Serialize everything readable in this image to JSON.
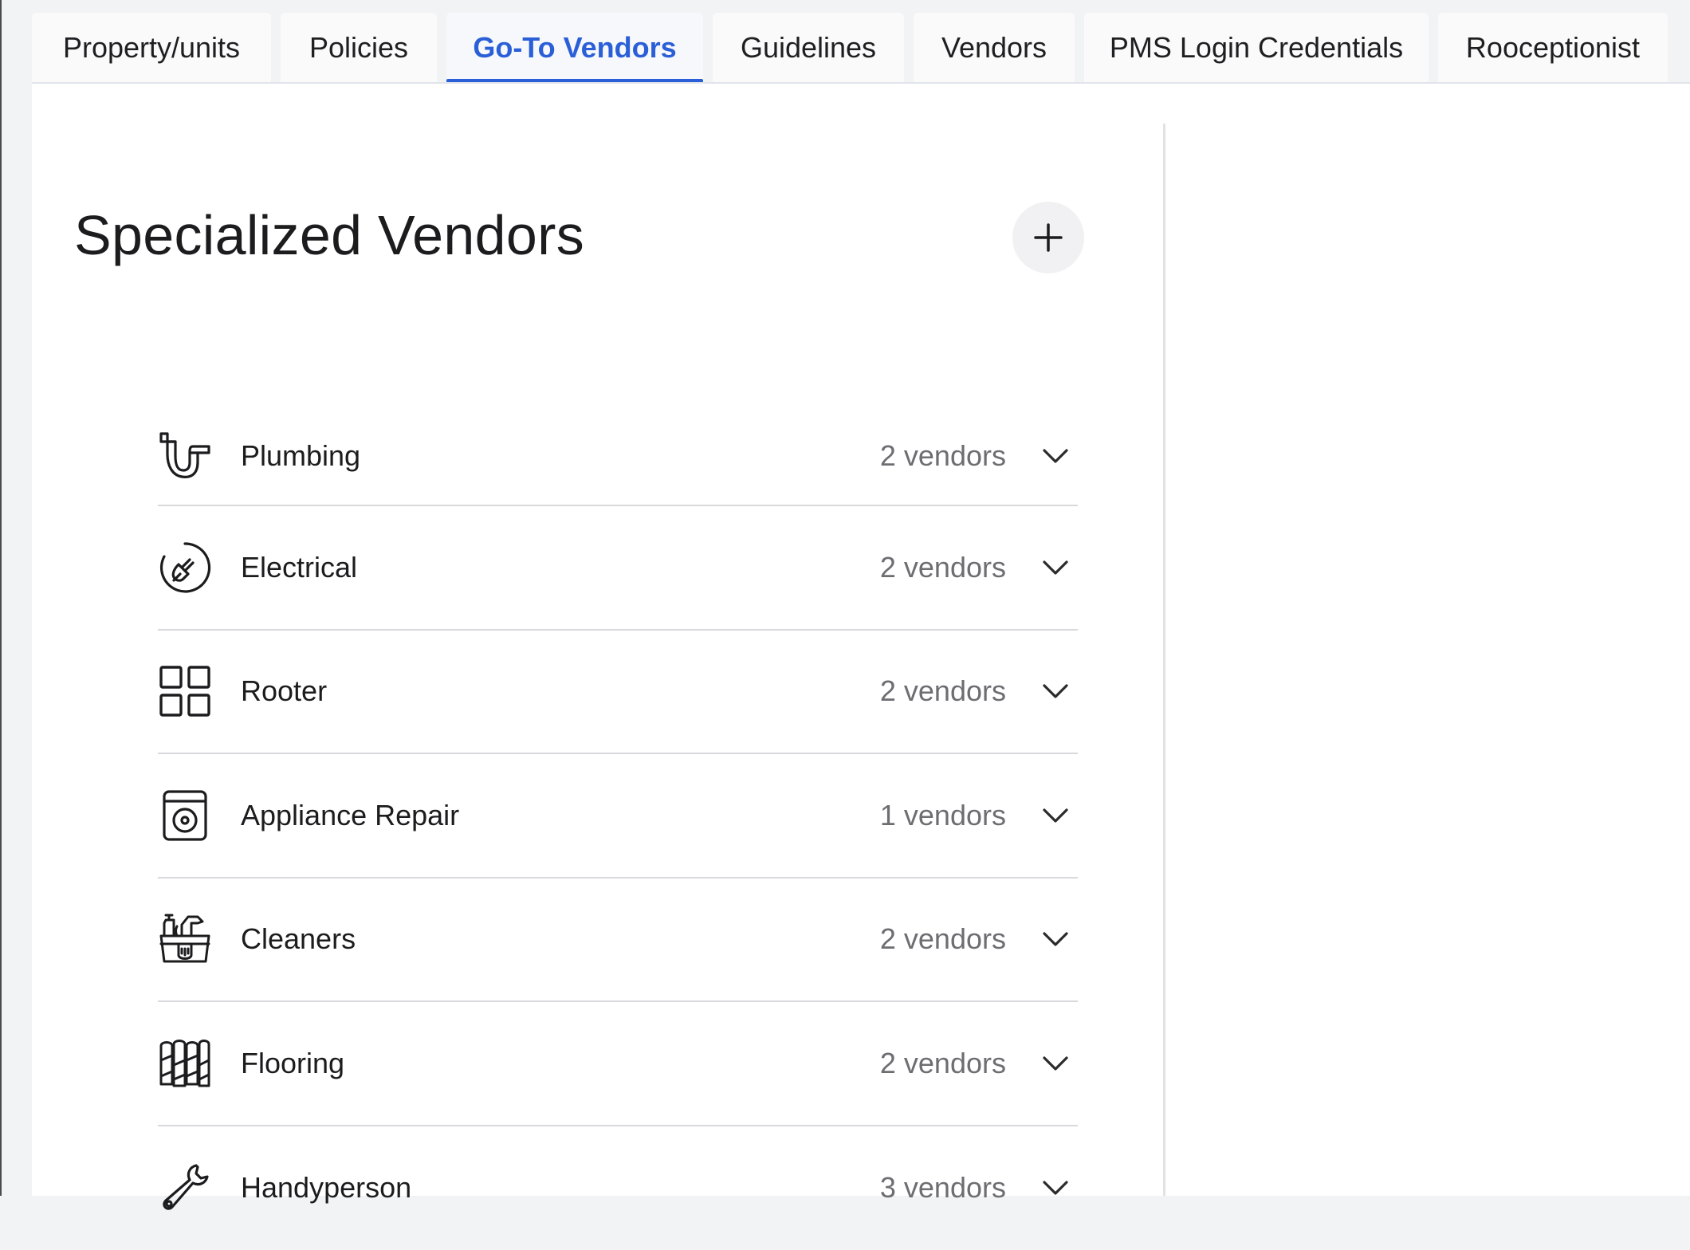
{
  "tabs": [
    {
      "label": "Property/units",
      "active": false
    },
    {
      "label": "Policies",
      "active": false
    },
    {
      "label": "Go-To Vendors",
      "active": true
    },
    {
      "label": "Guidelines",
      "active": false
    },
    {
      "label": "Vendors",
      "active": false
    },
    {
      "label": "PMS Login Credentials",
      "active": false
    },
    {
      "label": "Rooceptionist",
      "active": false
    }
  ],
  "page": {
    "title": "Specialized Vendors",
    "add_icon": "plus-icon"
  },
  "categories": [
    {
      "label": "Plumbing",
      "count": "2 vendors",
      "icon": "pipe-icon"
    },
    {
      "label": "Electrical",
      "count": "2 vendors",
      "icon": "plug-icon"
    },
    {
      "label": "Rooter",
      "count": "2 vendors",
      "icon": "grid-icon"
    },
    {
      "label": "Appliance Repair",
      "count": "1 vendors",
      "icon": "washer-icon"
    },
    {
      "label": "Cleaners",
      "count": "2 vendors",
      "icon": "cleaning-basket-icon"
    },
    {
      "label": "Flooring",
      "count": "2 vendors",
      "icon": "floor-panels-icon"
    },
    {
      "label": "Handyperson",
      "count": "3 vendors",
      "icon": "wrench-icon"
    }
  ],
  "colors": {
    "accent": "#2a5fd8",
    "divider": "#d9d9dd",
    "muted_text": "#6d6d72"
  }
}
